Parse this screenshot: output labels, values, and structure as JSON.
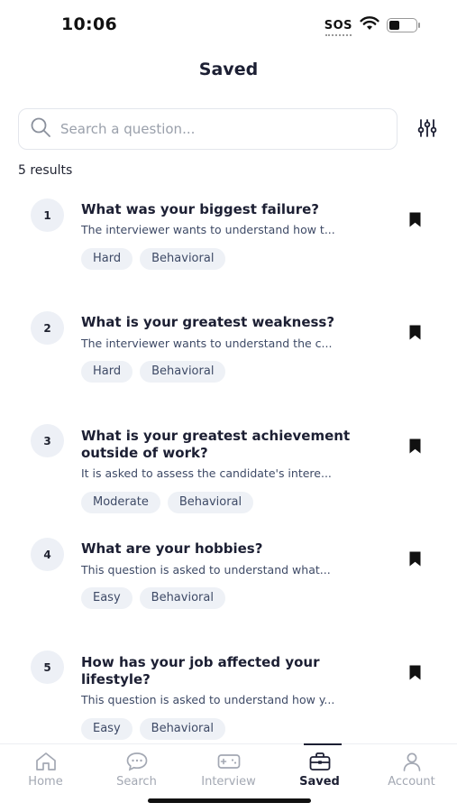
{
  "status_bar": {
    "time": "10:06",
    "sos": "SOS",
    "battery_level": 0.4
  },
  "header": {
    "title": "Saved"
  },
  "search": {
    "placeholder": "Search a question..."
  },
  "results": {
    "count_label": "5 results"
  },
  "questions": [
    {
      "number": "1",
      "title": "What was your biggest failure?",
      "description": "The interviewer wants to understand how t...",
      "tags": [
        "Hard",
        "Behavioral"
      ]
    },
    {
      "number": "2",
      "title": "What is your greatest weakness?",
      "description": "The interviewer wants to understand the c...",
      "tags": [
        "Hard",
        "Behavioral"
      ]
    },
    {
      "number": "3",
      "title": "What is your greatest achievement outside of work?",
      "description": "It is asked to assess the candidate's intere...",
      "tags": [
        "Moderate",
        "Behavioral"
      ]
    },
    {
      "number": "4",
      "title": "What are your hobbies?",
      "description": "This question is asked to understand what...",
      "tags": [
        "Easy",
        "Behavioral"
      ]
    },
    {
      "number": "5",
      "title": "How has your job affected your lifestyle?",
      "description": "This question is asked to understand how y...",
      "tags": [
        "Easy",
        "Behavioral"
      ]
    }
  ],
  "tab_bar": {
    "home": "Home",
    "search": "Search",
    "interview": "Interview",
    "saved": "Saved",
    "account": "Account",
    "active": "saved"
  }
}
